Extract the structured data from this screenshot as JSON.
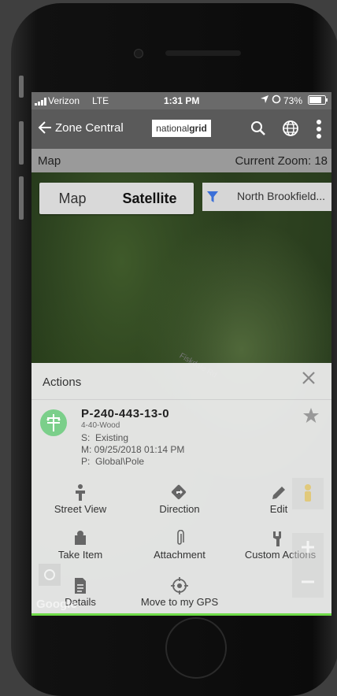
{
  "status": {
    "carrier": "Verizon",
    "network": "LTE",
    "time": "1:31 PM",
    "battery": "73%"
  },
  "appbar": {
    "back_label": "Zone Central",
    "logo_prefix": "national",
    "logo_bold": "grid"
  },
  "mapbar": {
    "left": "Map",
    "right": "Current Zoom: 18"
  },
  "map_toggle": {
    "map": "Map",
    "satellite": "Satellite"
  },
  "filter": {
    "label": "North Brookfield..."
  },
  "panel": {
    "title": "Actions",
    "item": {
      "id": "P-240-443-13-0",
      "type": "4-40-Wood",
      "status": "S:  Existing",
      "modified": "M: 09/25/2018 01:14 PM",
      "path": "P:  Global\\Pole"
    },
    "actions": {
      "street_view": "Street View",
      "direction": "Direction",
      "edit": "Edit",
      "take_item": "Take Item",
      "attachment": "Attachment",
      "custom_actions": "Custom Actions",
      "details": "Details",
      "move_gps": "Move to my GPS"
    }
  },
  "map_road": "Fiskdale Rd",
  "map_watermark": "Google",
  "colors": {
    "accent_green": "#6fdc48",
    "filter_blue": "#3a6fd8",
    "app_bar": "#5a5a5a"
  }
}
